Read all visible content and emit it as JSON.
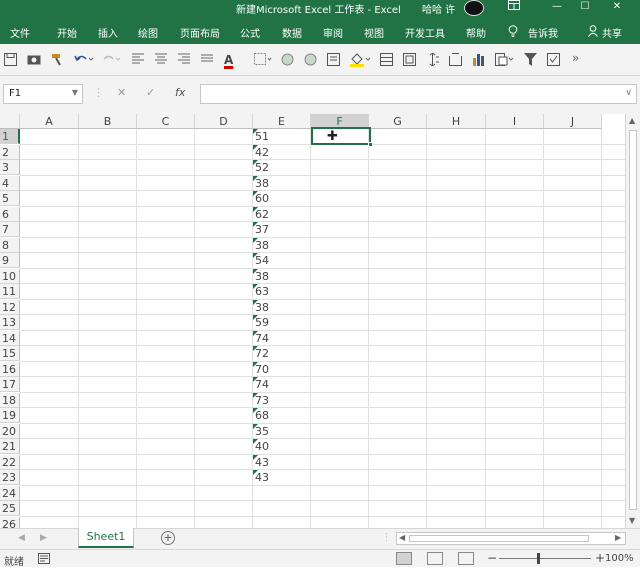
{
  "titlebar": {
    "title": "新建Microsoft Excel 工作表  -  Excel",
    "user": "哈哈 许",
    "ribbon_display_icon": "ribbon-display-icon",
    "minimize": "—",
    "maximize": "☐",
    "close": "✕"
  },
  "tabs": [
    "文件",
    "开始",
    "插入",
    "绘图",
    "页面布局",
    "公式",
    "数据",
    "审阅",
    "视图",
    "开发工具",
    "帮助"
  ],
  "tellme": "告诉我",
  "share": "共享",
  "toolbar": {
    "icons": [
      "save-icon",
      "camera-icon",
      "format-painter-icon",
      "undo-icon",
      "redo-icon",
      "align-left-icon",
      "align-center-icon",
      "align-right-icon",
      "justify-icon",
      "font-color-icon",
      "borders-icon",
      "circle-icon",
      "circle-icon",
      "fill-color-icon",
      "insert-icon",
      "wrap-icon",
      "row-height-icon",
      "frame-icon",
      "chart-icon",
      "paste-icon",
      "filter-icon",
      "checkbox-icon",
      "more-icon"
    ],
    "font_color_label": "A",
    "more_label": "»"
  },
  "formula_bar": {
    "namebox": "F1",
    "cancel": "✕",
    "enter": "✓",
    "fx": "fx",
    "value": ""
  },
  "columns": [
    "A",
    "B",
    "C",
    "D",
    "E",
    "F",
    "G",
    "H",
    "I",
    "J"
  ],
  "selected_column": "F",
  "rows": [
    "1",
    "2",
    "3",
    "4",
    "5",
    "6",
    "7",
    "8",
    "9",
    "10",
    "11",
    "12",
    "13",
    "14",
    "15",
    "16",
    "17",
    "18",
    "19",
    "20",
    "21",
    "22",
    "23",
    "24",
    "25",
    "26"
  ],
  "selected_row": "1",
  "column_e_values": [
    "51",
    "42",
    "52",
    "38",
    "60",
    "62",
    "37",
    "38",
    "54",
    "38",
    "63",
    "38",
    "59",
    "74",
    "72",
    "70",
    "74",
    "73",
    "68",
    "35",
    "40",
    "43",
    "43"
  ],
  "sheet": {
    "tab_name": "Sheet1",
    "add_label": "+"
  },
  "status": {
    "ready": "就绪",
    "zoom_minus": "−",
    "zoom_plus": "+",
    "zoom": "100%",
    "zoom_level_percent": 100
  }
}
